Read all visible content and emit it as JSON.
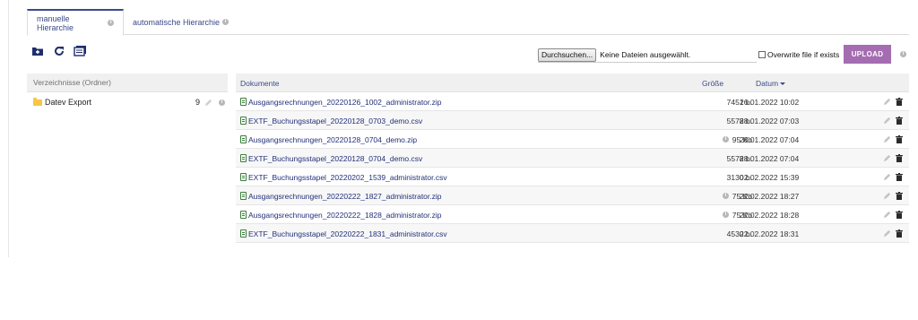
{
  "tabs": [
    {
      "label": "manuelle Hierarchie",
      "active": true
    },
    {
      "label": "automatische Hierarchie",
      "active": false
    }
  ],
  "toolbar": {
    "icons": [
      "new-folder-icon",
      "refresh-icon",
      "export-icon"
    ],
    "file_button": "Durchsuchen...",
    "file_status": "Keine Dateien ausgewählt.",
    "overwrite_label": "Overwrite file if exists",
    "upload_label": "UPLOAD"
  },
  "folders": {
    "header": "Verzeichnisse (Ordner)",
    "items": [
      {
        "name": "Datev Export",
        "count": "9"
      }
    ]
  },
  "documents": {
    "headers": {
      "name": "Dokumente",
      "size": "Größe",
      "date": "Datum"
    },
    "rows": [
      {
        "name": "Ausgangsrechnungen_20220126_1002_administrator.zip",
        "size": "7451 b.",
        "date": "26.01.2022 10:02",
        "size_info": false
      },
      {
        "name": "EXTF_Buchungsstapel_20220128_0703_demo.csv",
        "size": "5578 b.",
        "date": "28.01.2022 07:03",
        "size_info": false
      },
      {
        "name": "Ausgangsrechnungen_20220128_0704_demo.zip",
        "size": "95 Kb",
        "date": "28.01.2022 07:04",
        "size_info": true
      },
      {
        "name": "EXTF_Buchungsstapel_20220128_0704_demo.csv",
        "size": "5578 b.",
        "date": "28.01.2022 07:04",
        "size_info": false
      },
      {
        "name": "EXTF_Buchungsstapel_20220202_1539_administrator.csv",
        "size": "3130 b.",
        "date": "02.02.2022 15:39",
        "size_info": false
      },
      {
        "name": "Ausgangsrechnungen_20220222_1827_administrator.zip",
        "size": "75 Kb",
        "date": "22.02.2022 18:27",
        "size_info": true
      },
      {
        "name": "Ausgangsrechnungen_20220222_1828_administrator.zip",
        "size": "75 Kb",
        "date": "22.02.2022 18:28",
        "size_info": true
      },
      {
        "name": "EXTF_Buchungsstapel_20220222_1831_administrator.csv",
        "size": "4530 b.",
        "date": "22.02.2022 18:31",
        "size_info": false
      }
    ]
  },
  "colors": {
    "accent": "#3b4a8a",
    "upload": "#a56db1",
    "file_icon": "#3a7d3a",
    "folder": "#f6c644"
  }
}
